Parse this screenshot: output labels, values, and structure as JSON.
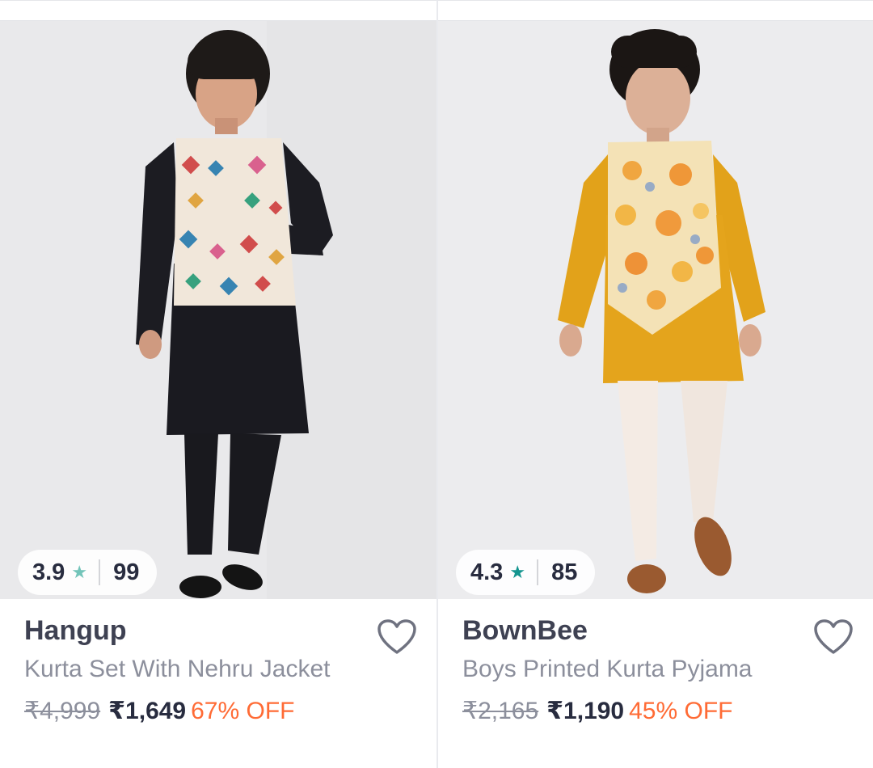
{
  "products": [
    {
      "brand": "Hangup",
      "name": "Kurta Set With Nehru Jacket",
      "rating": "3.9",
      "rating_count": "99",
      "mrp": "₹4,999",
      "price": "₹1,649",
      "discount": "67% OFF",
      "star_color": "#72c4b9",
      "wishlist_icon": "heart-outline-icon"
    },
    {
      "brand": "BownBee",
      "name": "Boys Printed Kurta Pyjama",
      "rating": "4.3",
      "rating_count": "85",
      "mrp": "₹2,165",
      "price": "₹1,190",
      "discount": "45% OFF",
      "star_color": "#14958f",
      "wishlist_icon": "heart-outline-icon"
    }
  ],
  "colors": {
    "brand_text": "#3e4152",
    "muted_text": "#8c8f9c",
    "discount": "#ff6b35"
  }
}
